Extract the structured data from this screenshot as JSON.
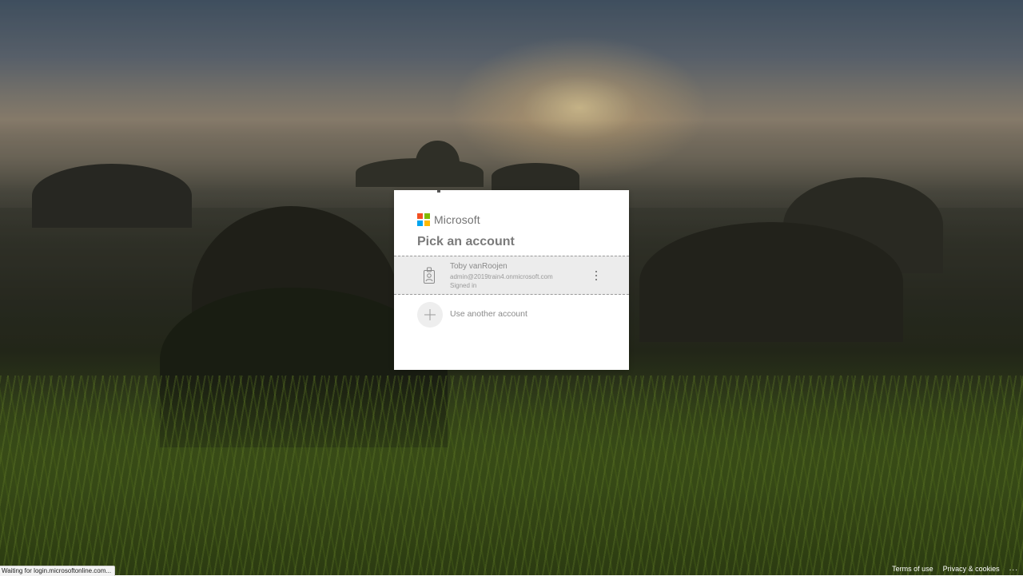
{
  "brand": {
    "name": "Microsoft",
    "logo_colors": [
      "#f25022",
      "#7fba00",
      "#00a4ef",
      "#ffb900"
    ]
  },
  "dialog": {
    "title": "Pick an account",
    "accounts": [
      {
        "name": "Toby vanRoojen",
        "email": "admin@2019train4.onmicrosoft.com",
        "status": "Signed in",
        "icon": "badge-icon"
      }
    ],
    "add_account_label": "Use another account"
  },
  "status_bar": {
    "text": "Waiting for login.microsoftonline.com..."
  },
  "footer": {
    "terms_label": "Terms of use",
    "privacy_label": "Privacy & cookies",
    "more_label": "..."
  },
  "colors": {
    "tile_background": "#ececec",
    "text_muted": "#7a7a7a"
  }
}
